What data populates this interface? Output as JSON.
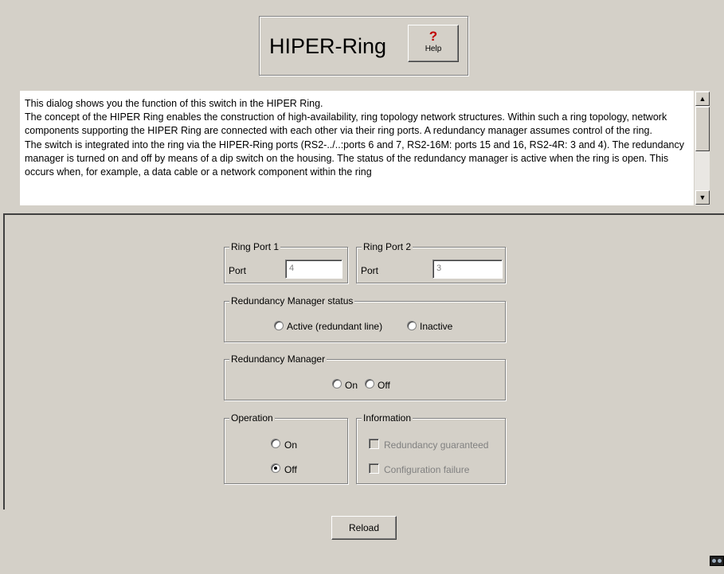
{
  "header": {
    "title": "HIPER-Ring",
    "help_label": "Help"
  },
  "description": [
    "This dialog shows you the function of this switch in the HIPER Ring.",
    "The concept of the HIPER Ring enables the construction of high-availability, ring topology network structures. Within such a ring topology, network components supporting the HIPER Ring are connected with each other via their ring ports. A redundancy manager assumes control of the ring.",
    "The switch is integrated into the ring via the HIPER-Ring ports (RS2-../..:ports 6 and 7, RS2-16M: ports 15 and 16, RS2-4R: 3 and 4). The redundancy manager is turned on and off by means of a dip switch on the housing. The status of the redundancy manager is active when the ring is open. This occurs when, for example, a data cable or a network component within the ring"
  ],
  "ring_port_1": {
    "legend": "Ring Port 1",
    "port_label": "Port",
    "value": "4"
  },
  "ring_port_2": {
    "legend": "Ring Port 2",
    "port_label": "Port",
    "value": "3"
  },
  "rm_status": {
    "legend": "Redundancy Manager status",
    "options": [
      "Active (redundant line)",
      "Inactive"
    ],
    "selected": null
  },
  "redundancy_manager": {
    "legend": "Redundancy Manager",
    "options": [
      "On",
      "Off"
    ],
    "selected": null
  },
  "operation": {
    "legend": "Operation",
    "options": [
      "On",
      "Off"
    ],
    "selected": "Off"
  },
  "information": {
    "legend": "Information",
    "items": [
      "Redundancy guaranteed",
      "Configuration failure"
    ]
  },
  "footer": {
    "reload_label": "Reload"
  },
  "icons": {
    "scroll_up": "scroll-up-arrow",
    "scroll_down": "scroll-down-arrow",
    "status": "connection-status-icon"
  }
}
